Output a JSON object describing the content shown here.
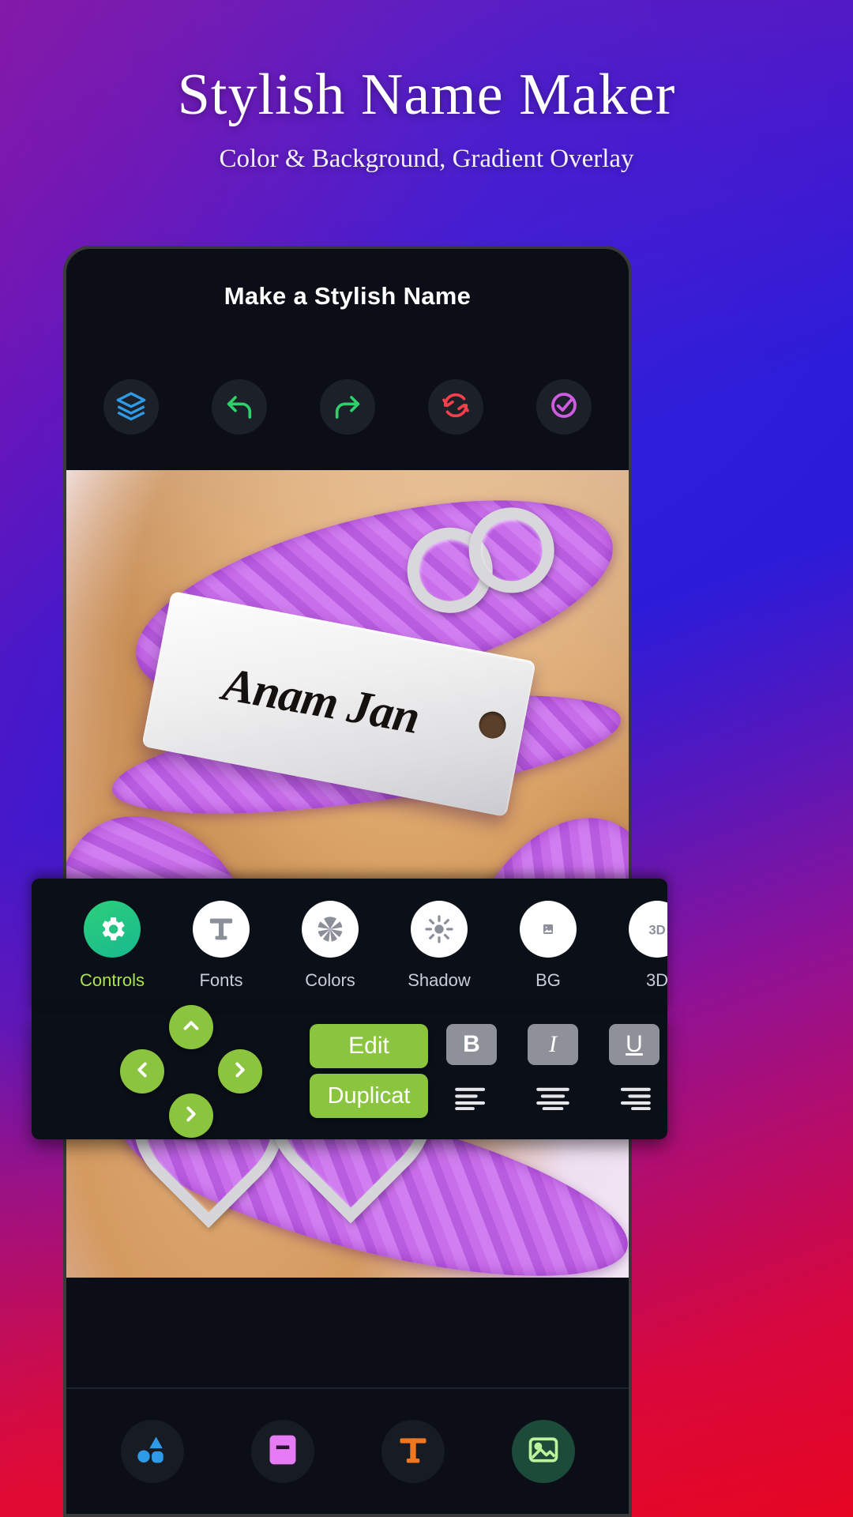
{
  "promo": {
    "title": "Stylish Name Maker",
    "subtitle": "Color & Background, Gradient Overlay"
  },
  "app": {
    "header_title": "Make a Stylish Name",
    "toolbar": [
      {
        "name": "layers-icon",
        "label": "Layers",
        "color": "#2f9ae8"
      },
      {
        "name": "undo-icon",
        "label": "Undo",
        "color": "#2fcf6a"
      },
      {
        "name": "redo-icon",
        "label": "Redo",
        "color": "#2fcf6a"
      },
      {
        "name": "reset-icon",
        "label": "Reset",
        "color": "#f4404a"
      },
      {
        "name": "done-icon",
        "label": "Done",
        "color": "#cf5be0"
      }
    ],
    "canvas": {
      "name_text": "Anam Jan",
      "bracelet_color": "#c96eea"
    },
    "tabs": [
      {
        "label": "Controls",
        "icon": "gear-icon",
        "active": true
      },
      {
        "label": "Fonts",
        "icon": "text-t-icon",
        "active": false
      },
      {
        "label": "Colors",
        "icon": "color-wheel-icon",
        "active": false
      },
      {
        "label": "Shadow",
        "icon": "sun-icon",
        "active": false
      },
      {
        "label": "BG",
        "icon": "image-icon",
        "active": false
      },
      {
        "label": "3D",
        "icon": "cube-3d-icon",
        "active": false
      }
    ],
    "controls": {
      "dpad": [
        {
          "name": "move-up-button",
          "dir": "up"
        },
        {
          "name": "move-left-button",
          "dir": "left"
        },
        {
          "name": "move-right-button",
          "dir": "right"
        },
        {
          "name": "move-down-button",
          "dir": "down"
        }
      ],
      "edit_label": "Edit",
      "duplicate_label": "Duplicat",
      "bold_label": "B",
      "italic_label": "I",
      "underline_label": "U",
      "align_left": "align-left-icon",
      "align_center": "align-center-icon",
      "align_right": "align-right-icon"
    },
    "bottom_nav": [
      {
        "name": "shapes-icon",
        "label": "Shapes",
        "color": "#2f9ae8"
      },
      {
        "name": "template-icon",
        "label": "Templates",
        "color": "#e77bf5"
      },
      {
        "name": "text-icon",
        "label": "Text",
        "color": "#f0761f"
      },
      {
        "name": "gallery-icon",
        "label": "Gallery",
        "color": "#9fe870"
      }
    ]
  },
  "colors": {
    "accent_green": "#8bc53f",
    "tab_active": "#a9e34b",
    "panel_bg": "#0b0f18"
  }
}
